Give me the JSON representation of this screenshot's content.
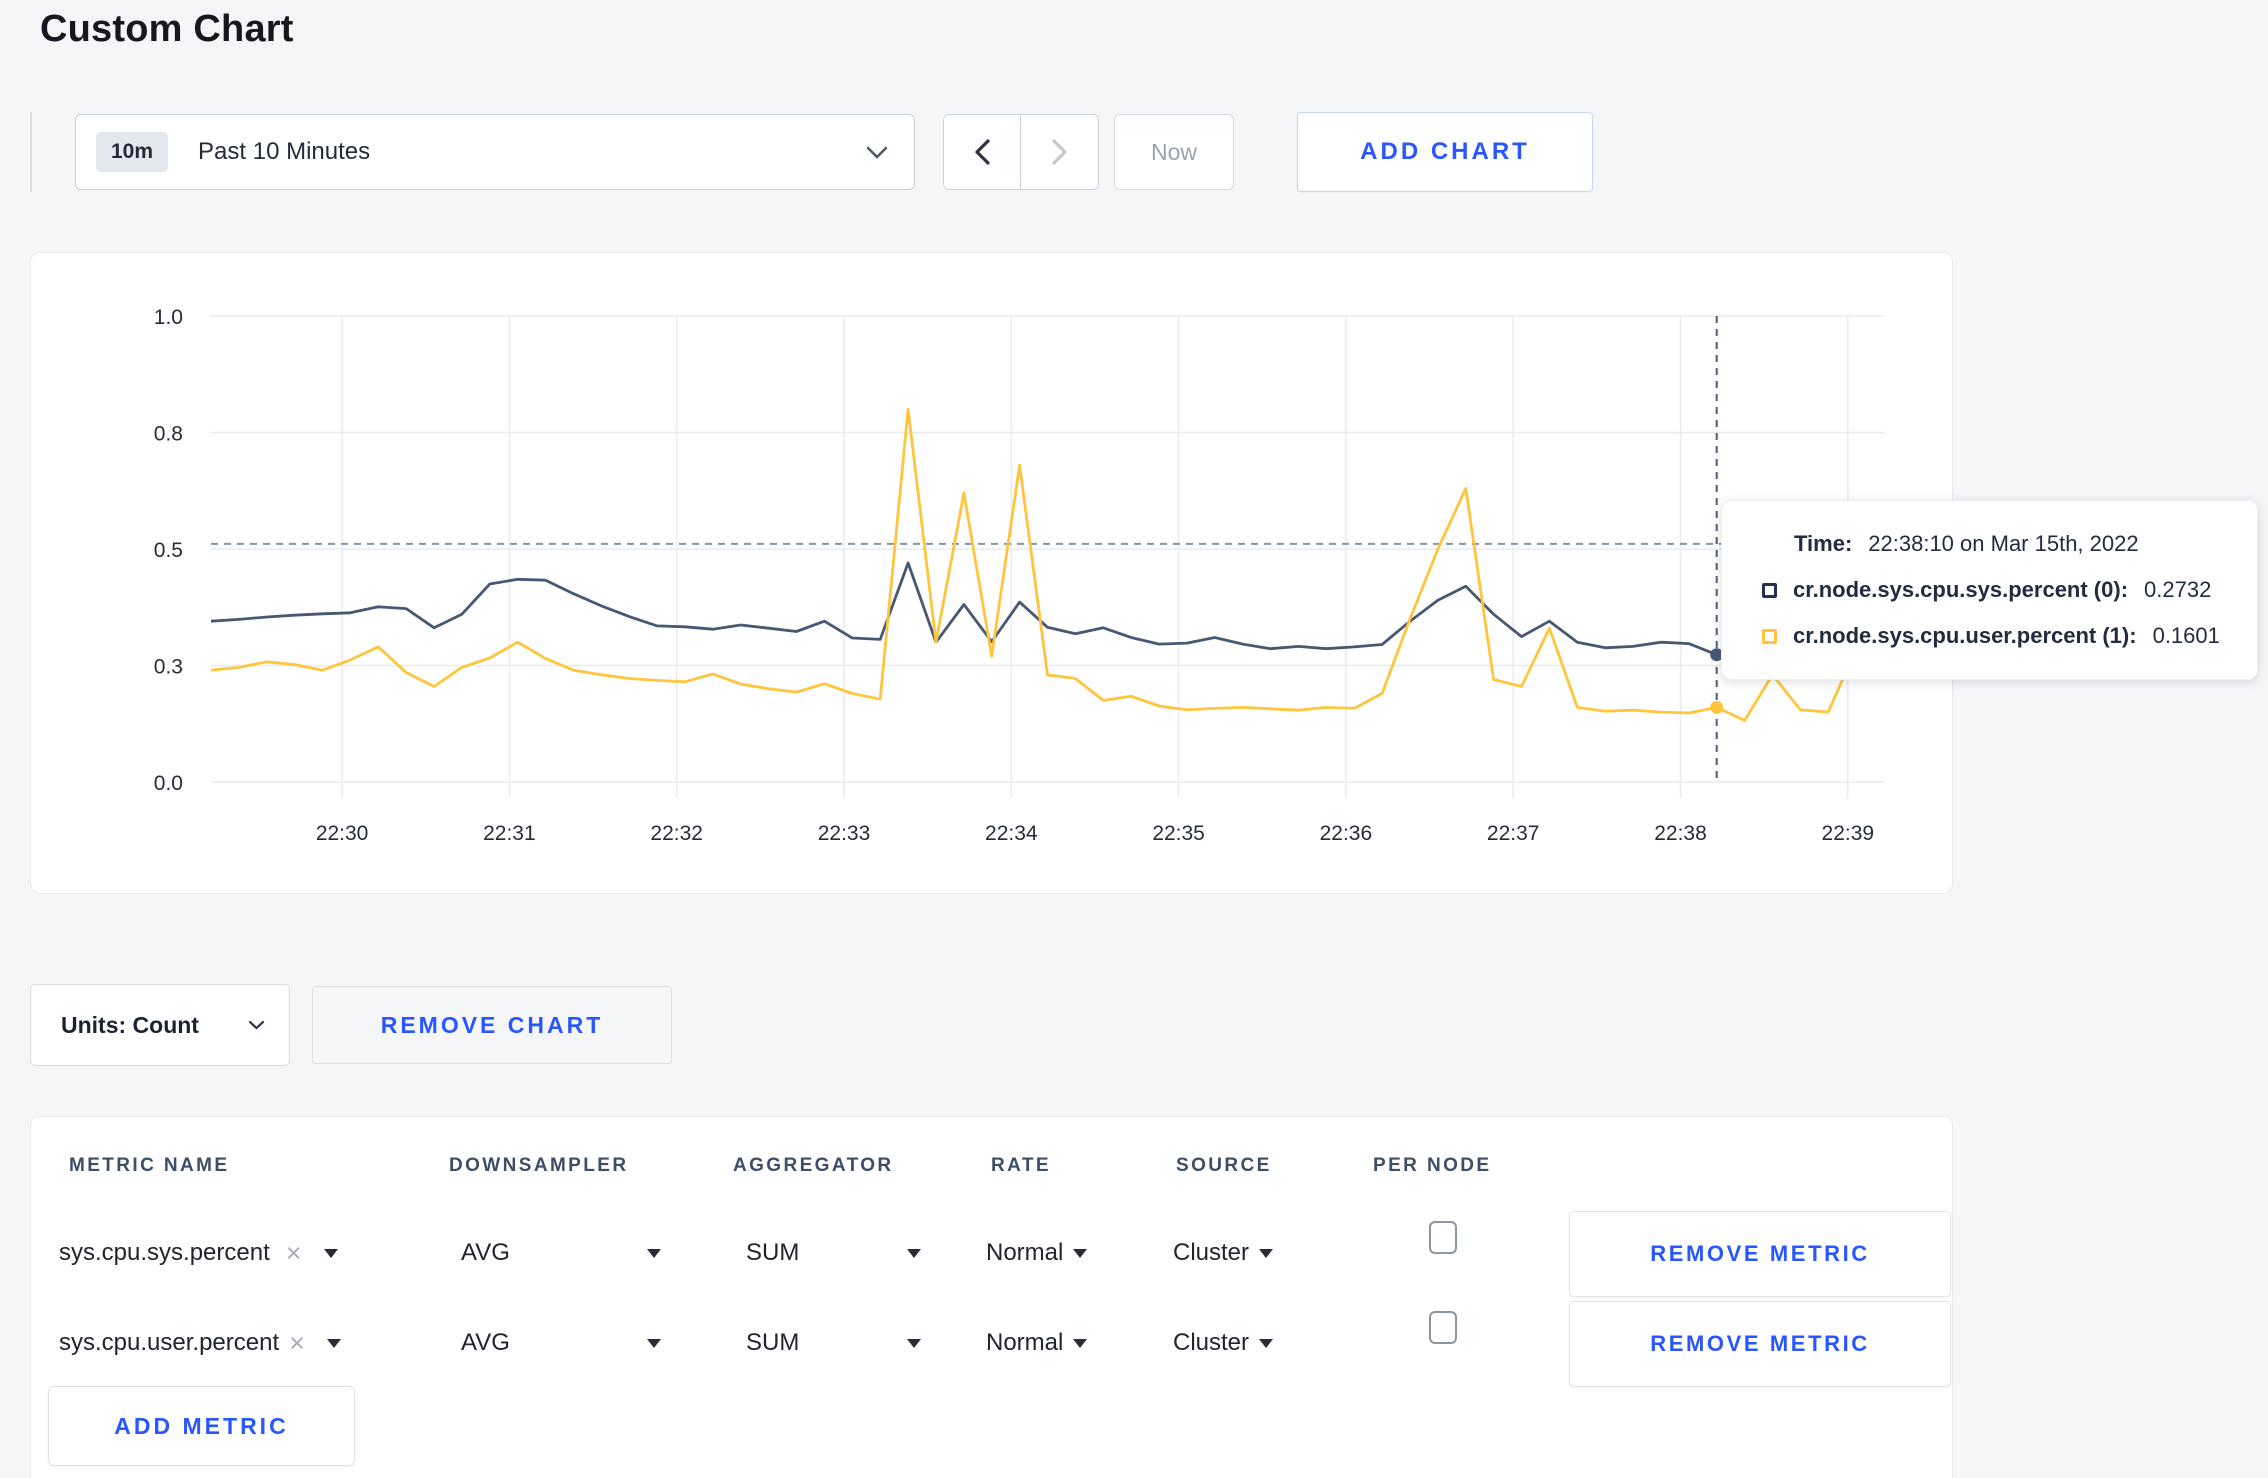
{
  "page": {
    "title": "Custom Chart",
    "background": "#f5f6f8",
    "accent_blue": "#2956ff"
  },
  "toolbar": {
    "time_range": {
      "badge": "10m",
      "label": "Past 10 Minutes"
    },
    "now_label": "Now",
    "add_chart_label": "ADD CHART"
  },
  "chart_data": {
    "type": "line",
    "title": "",
    "xlabel": "",
    "ylabel": "",
    "ylim": [
      0,
      1
    ],
    "grid": true,
    "x_start_time": "22:29:13",
    "x_step_seconds": 10,
    "x_ticks": {
      "labels": [
        "22:30",
        "22:31",
        "22:32",
        "22:33",
        "22:34",
        "22:35",
        "22:36",
        "22:37",
        "22:38",
        "22:39"
      ],
      "first_offset_s": 47,
      "interval_s": 60,
      "span_s": 600
    },
    "y_ticks": {
      "labels": [
        "0.0",
        "0.3",
        "0.5",
        "0.8",
        "1.0"
      ],
      "values": [
        0,
        0.25,
        0.5,
        0.75,
        1.0
      ]
    },
    "guidelines": {
      "horizontal_value": 0.511
    },
    "crosshair": {
      "index": 54,
      "time": "22:38:10"
    },
    "series": [
      {
        "name": "cr.node.sys.cpu.sys.percent (0)",
        "color": "#475872",
        "values": [
          0.345,
          0.349,
          0.354,
          0.358,
          0.361,
          0.363,
          0.376,
          0.372,
          0.331,
          0.36,
          0.425,
          0.435,
          0.433,
          0.404,
          0.378,
          0.355,
          0.335,
          0.333,
          0.328,
          0.337,
          0.33,
          0.323,
          0.345,
          0.309,
          0.306,
          0.47,
          0.3,
          0.381,
          0.301,
          0.386,
          0.332,
          0.318,
          0.331,
          0.31,
          0.296,
          0.298,
          0.31,
          0.296,
          0.286,
          0.291,
          0.286,
          0.29,
          0.295,
          0.345,
          0.39,
          0.42,
          0.36,
          0.312,
          0.345,
          0.3,
          0.288,
          0.291,
          0.3,
          0.297,
          0.2732,
          0.296,
          0.32,
          0.301,
          0.297,
          0.3,
          0.305
        ]
      },
      {
        "name": "cr.node.sys.cpu.user.percent (1)",
        "color": "#ffc53d",
        "values": [
          0.24,
          0.246,
          0.258,
          0.252,
          0.24,
          0.262,
          0.29,
          0.235,
          0.205,
          0.246,
          0.266,
          0.3,
          0.265,
          0.24,
          0.23,
          0.222,
          0.218,
          0.215,
          0.232,
          0.21,
          0.2,
          0.193,
          0.211,
          0.19,
          0.178,
          0.8,
          0.3,
          0.62,
          0.27,
          0.68,
          0.23,
          0.222,
          0.175,
          0.184,
          0.163,
          0.155,
          0.158,
          0.16,
          0.157,
          0.154,
          0.16,
          0.158,
          0.19,
          0.35,
          0.5,
          0.63,
          0.22,
          0.205,
          0.33,
          0.16,
          0.152,
          0.154,
          0.15,
          0.148,
          0.1601,
          0.132,
          0.23,
          0.155,
          0.15,
          0.285,
          0.245
        ]
      }
    ]
  },
  "tooltip": {
    "time_label": "Time:",
    "time_value": "22:38:10 on Mar 15th, 2022",
    "series": [
      {
        "name": "cr.node.sys.cpu.sys.percent (0):",
        "value": "0.2732",
        "swatch_color": "#253150"
      },
      {
        "name": "cr.node.sys.cpu.user.percent (1):",
        "value": "0.1601",
        "swatch_color": "#ffc53d"
      }
    ]
  },
  "chart_footer": {
    "units_label": "Units: Count",
    "remove_chart_label": "REMOVE CHART"
  },
  "metrics_table": {
    "headers": [
      "METRIC NAME",
      "DOWNSAMPLER",
      "AGGREGATOR",
      "RATE",
      "SOURCE",
      "PER NODE"
    ],
    "rows": [
      {
        "metric": "sys.cpu.sys.percent",
        "downsampler": "AVG",
        "aggregator": "SUM",
        "rate": "Normal",
        "source": "Cluster",
        "per_node_checked": false,
        "remove_label": "REMOVE METRIC"
      },
      {
        "metric": "sys.cpu.user.percent",
        "downsampler": "AVG",
        "aggregator": "SUM",
        "rate": "Normal",
        "source": "Cluster",
        "per_node_checked": false,
        "remove_label": "REMOVE METRIC"
      }
    ],
    "add_metric_label": "ADD METRIC"
  }
}
